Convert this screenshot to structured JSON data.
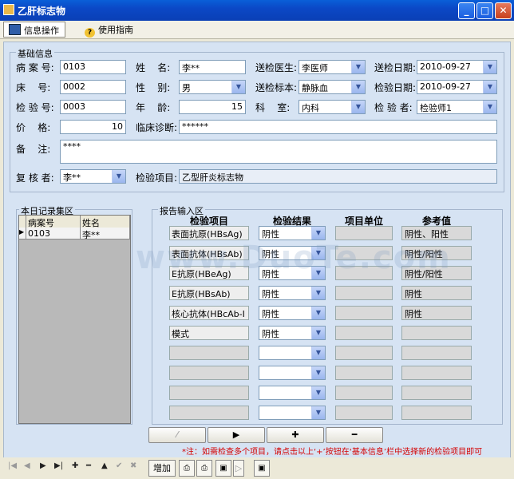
{
  "window": {
    "title": "乙肝标志物",
    "min": "_",
    "max": "□",
    "close": "✕"
  },
  "toolbar": {
    "tab_info": "信息操作",
    "tab_guide": "使用指南"
  },
  "basic": {
    "legend": "基础信息",
    "case_no_label": "病 案 号:",
    "case_no": "0103",
    "name_label": "姓    名:",
    "name": "李**",
    "doctor_label": "送检医生:",
    "doctor": "李医师",
    "send_date_label": "送检日期:",
    "send_date": "2010-09-27",
    "bed_label": "床    号:",
    "bed": "0002",
    "sex_label": "性    别:",
    "sex": "男",
    "sample_label": "送检标本:",
    "sample": "静脉血",
    "test_date_label": "检验日期:",
    "test_date": "2010-09-27",
    "test_no_label": "检 验 号:",
    "test_no": "0003",
    "age_label": "年    龄:",
    "age": "15",
    "dept_label": "科    室:",
    "dept": "内科",
    "tester_label": "检 验 者:",
    "tester": "检验师1",
    "price_label": "价    格:",
    "price": "10",
    "diag_label": "临床诊断:",
    "diag": "******",
    "note_label": "备    注:",
    "note": "****",
    "reviewer_label": "复 核 者:",
    "reviewer": "李**",
    "item_label": "检验项目:",
    "item": "乙型肝炎标志物"
  },
  "records": {
    "legend": "本日记录集区",
    "headers": [
      "病案号",
      "姓名"
    ],
    "rows": [
      {
        "case_no": "0103",
        "name": "李**"
      }
    ]
  },
  "report": {
    "legend": "报告输入区",
    "headers": [
      "检验项目",
      "检验结果",
      "项目单位",
      "参考值"
    ],
    "rows": [
      {
        "item": "表面抗原(HBsAg)",
        "result": "阴性",
        "unit": "",
        "ref": "阴性、阳性"
      },
      {
        "item": "表面抗体(HBsAb)",
        "result": "阴性",
        "unit": "",
        "ref": "阴性/阳性"
      },
      {
        "item": "E抗原(HBeAg)",
        "result": "阴性",
        "unit": "",
        "ref": "阴性/阳性"
      },
      {
        "item": "E抗原(HBsAb)",
        "result": "阴性",
        "unit": "",
        "ref": "阴性"
      },
      {
        "item": "核心抗体(HBcAb-I",
        "result": "阴性",
        "unit": "",
        "ref": "阴性"
      },
      {
        "item": "模式",
        "result": "阴性",
        "unit": "",
        "ref": ""
      },
      {
        "item": "",
        "result": "",
        "unit": "",
        "ref": ""
      },
      {
        "item": "",
        "result": "",
        "unit": "",
        "ref": ""
      },
      {
        "item": "",
        "result": "",
        "unit": "",
        "ref": ""
      },
      {
        "item": "",
        "result": "",
        "unit": "",
        "ref": ""
      }
    ],
    "buttons": [
      "⁄",
      "▶",
      "✚",
      "━"
    ],
    "note": "*注：如需检查多个项目，请点击以上‘+’按钮在‘基本信息’栏中选择新的检验项目即可"
  },
  "statusbar": {
    "add_label": "增加"
  },
  "watermark": "www.DuoTe.com",
  "colors": {
    "title_bar": "#0b48c6",
    "panel": "#d6e3f3",
    "note_red": "#d40000"
  }
}
